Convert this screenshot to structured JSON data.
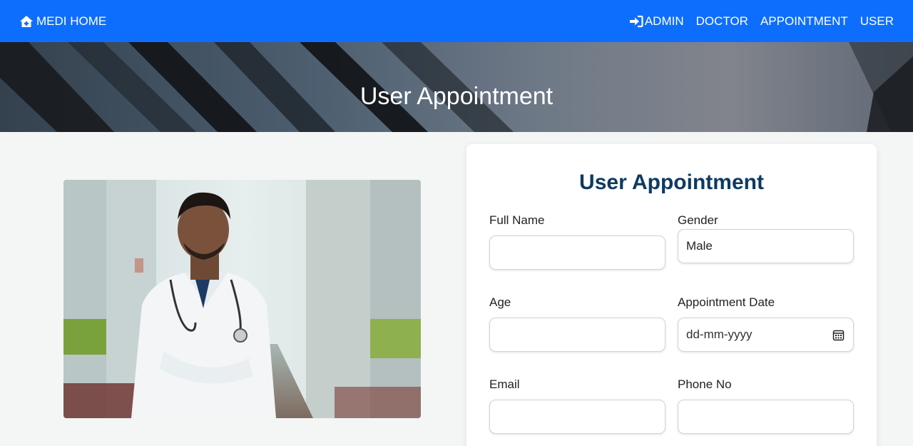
{
  "navbar": {
    "brand_label": "MEDI HOME",
    "brand_icon": "home-icon",
    "links": [
      {
        "label": "ADMIN",
        "icon": "login-icon"
      },
      {
        "label": "DOCTOR"
      },
      {
        "label": "APPOINTMENT"
      },
      {
        "label": "USER"
      }
    ],
    "background_color": "#0d6efd"
  },
  "banner": {
    "title": "User Appointment"
  },
  "form": {
    "title": "User Appointment",
    "title_color": "#0e3a62",
    "fields": {
      "full_name": {
        "label": "Full Name",
        "value": ""
      },
      "gender": {
        "label": "Gender",
        "value": "Male"
      },
      "age": {
        "label": "Age",
        "value": ""
      },
      "appointment_date": {
        "label": "Appointment Date",
        "placeholder": "dd-mm-yyyy",
        "icon": "calendar-icon"
      },
      "email": {
        "label": "Email",
        "value": ""
      },
      "phone": {
        "label": "Phone No",
        "value": ""
      }
    }
  }
}
